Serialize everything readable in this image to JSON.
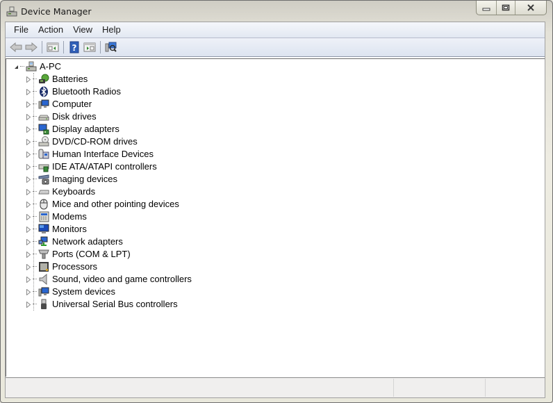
{
  "window": {
    "title": "Device Manager",
    "icon": "device-manager-icon",
    "controls": {
      "minimize": "minimize",
      "maximize": "maximize",
      "close": "close"
    }
  },
  "menu": {
    "items": [
      {
        "label": "File"
      },
      {
        "label": "Action"
      },
      {
        "label": "View"
      },
      {
        "label": "Help"
      }
    ]
  },
  "toolbar": {
    "buttons": [
      {
        "name": "back",
        "icon": "arrow-left-icon"
      },
      {
        "name": "forward",
        "icon": "arrow-right-icon"
      },
      {
        "name": "show-hide-console-tree",
        "icon": "console-tree-icon"
      },
      {
        "name": "help",
        "icon": "help-icon"
      },
      {
        "name": "show-hide-action-pane",
        "icon": "action-pane-icon"
      },
      {
        "name": "scan-for-hardware-changes",
        "icon": "scan-hardware-icon"
      }
    ]
  },
  "tree": {
    "root": {
      "label": "A-PC",
      "expanded": true,
      "icon": "computer-icon"
    },
    "items": [
      {
        "label": "Batteries",
        "icon": "battery-icon"
      },
      {
        "label": "Bluetooth Radios",
        "icon": "bluetooth-icon"
      },
      {
        "label": "Computer",
        "icon": "computer-icon"
      },
      {
        "label": "Disk drives",
        "icon": "disk-drive-icon"
      },
      {
        "label": "Display adapters",
        "icon": "display-adapter-icon"
      },
      {
        "label": "DVD/CD-ROM drives",
        "icon": "dvd-drive-icon"
      },
      {
        "label": "Human Interface Devices",
        "icon": "hid-icon"
      },
      {
        "label": "IDE ATA/ATAPI controllers",
        "icon": "ide-controller-icon"
      },
      {
        "label": "Imaging devices",
        "icon": "camera-icon"
      },
      {
        "label": "Keyboards",
        "icon": "keyboard-icon"
      },
      {
        "label": "Mice and other pointing devices",
        "icon": "mouse-icon"
      },
      {
        "label": "Modems",
        "icon": "modem-icon"
      },
      {
        "label": "Monitors",
        "icon": "monitor-icon"
      },
      {
        "label": "Network adapters",
        "icon": "network-adapter-icon"
      },
      {
        "label": "Ports (COM & LPT)",
        "icon": "port-icon"
      },
      {
        "label": "Processors",
        "icon": "processor-icon"
      },
      {
        "label": "Sound, video and game controllers",
        "icon": "speaker-icon"
      },
      {
        "label": "System devices",
        "icon": "system-devices-icon"
      },
      {
        "label": "Universal Serial Bus controllers",
        "icon": "usb-icon"
      }
    ]
  },
  "statusbar": {
    "panes": [
      "",
      "",
      ""
    ]
  }
}
